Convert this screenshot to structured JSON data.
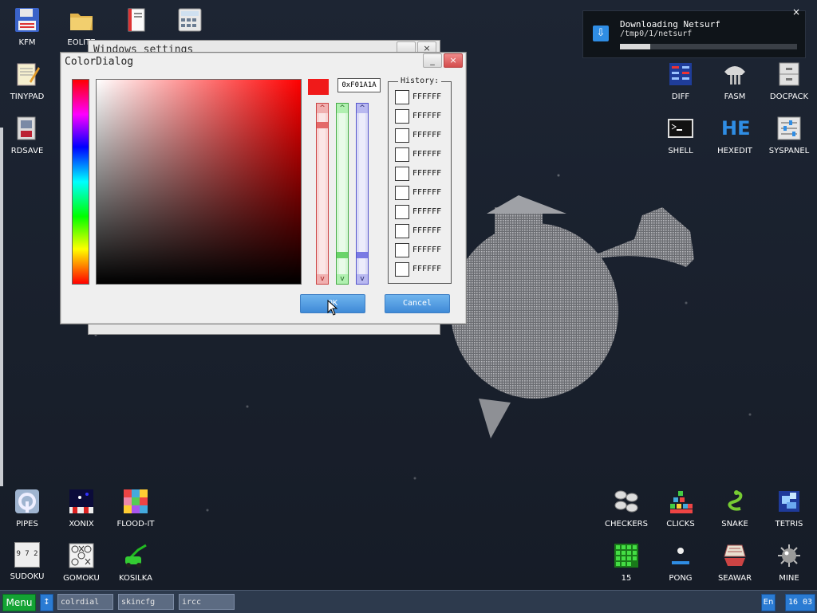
{
  "desktop": {
    "icons_left": [
      {
        "name": "kfm",
        "label": "KFM"
      },
      {
        "name": "eolite",
        "label": "EOLITE"
      },
      {
        "name": "tinypad",
        "label": "TINYPAD"
      },
      {
        "name": "rdsave",
        "label": "RDSAVE"
      }
    ],
    "icons_right": [
      {
        "name": "diff",
        "label": "DIFF"
      },
      {
        "name": "fasm",
        "label": "FASM"
      },
      {
        "name": "docpack",
        "label": "DOCPACK"
      },
      {
        "name": "shell",
        "label": "SHELL"
      },
      {
        "name": "hexedit",
        "label": "HEXEDIT"
      },
      {
        "name": "syspanel",
        "label": "SYSPANEL"
      }
    ],
    "icons_bottom_left": [
      {
        "name": "pipes",
        "label": "PIPES"
      },
      {
        "name": "xonix",
        "label": "XONIX"
      },
      {
        "name": "flood-it",
        "label": "FLOOD-IT"
      },
      {
        "name": "sudoku",
        "label": "SUDOKU"
      },
      {
        "name": "gomoku",
        "label": "GOMOKU"
      },
      {
        "name": "kosilka",
        "label": "KOSILKA"
      }
    ],
    "icons_bottom_right": [
      {
        "name": "checkers",
        "label": "CHECKERS"
      },
      {
        "name": "clicks",
        "label": "CLICKS"
      },
      {
        "name": "snake",
        "label": "SNAKE"
      },
      {
        "name": "tetris",
        "label": "TETRIS"
      },
      {
        "name": "15",
        "label": "15"
      },
      {
        "name": "pong",
        "label": "PONG"
      },
      {
        "name": "seawar",
        "label": "SEAWAR"
      },
      {
        "name": "mine",
        "label": "MINE"
      }
    ],
    "hexedit_glyph": "HE",
    "sudoku_glyph": "9 7 2",
    "icon_mini_text": "MENU"
  },
  "notification": {
    "title": "Downloading Netsurf",
    "path": "/tmp0/1/netsurf",
    "progress": 0.17,
    "close": "×",
    "icon": "download-icon"
  },
  "background_window": {
    "title": "Windows settings",
    "min": "_",
    "close": "×"
  },
  "color_dialog": {
    "title": "ColorDialog",
    "min": "_",
    "close": "×",
    "hex_value": "0xF01A1A",
    "current_color": "#f01a1a",
    "history_label": "History:",
    "history": [
      "FFFFFF",
      "FFFFFF",
      "FFFFFF",
      "FFFFFF",
      "FFFFFF",
      "FFFFFF",
      "FFFFFF",
      "FFFFFF",
      "FFFFFF",
      "FFFFFF"
    ],
    "ok_label": "OK",
    "cancel_label": "Cancel",
    "slider_up": "^",
    "slider_down": "v",
    "red_value": 240,
    "green_value": 26,
    "blue_value": 26
  },
  "taskbar": {
    "menu_label": "Menu",
    "switch_label": "↕",
    "tasks": [
      "colrdial",
      "skincfg",
      "ircc"
    ],
    "lang": "En",
    "clock": "16 03"
  },
  "colors": {
    "accent_blue": "#2a7bd3",
    "menu_green": "#13a334",
    "red_slider": "#f3caca",
    "green_slider": "#c9f3c9",
    "blue_slider": "#cfcff5"
  }
}
